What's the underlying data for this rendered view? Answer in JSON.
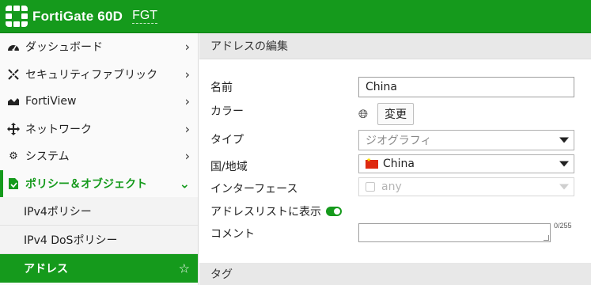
{
  "header": {
    "brand": "FortiGate 60D",
    "hostname": "FGT",
    "brand_color": "#159a1c"
  },
  "sidebar": {
    "items": [
      {
        "label": "ダッシュボード",
        "icon": "dashboard-icon"
      },
      {
        "label": "セキュリティファブリック",
        "icon": "security-fabric-icon"
      },
      {
        "label": "FortiView",
        "icon": "chart-icon"
      },
      {
        "label": "ネットワーク",
        "icon": "network-icon"
      },
      {
        "label": "システム",
        "icon": "gear-icon"
      },
      {
        "label": "ポリシー＆オブジェクト",
        "icon": "policy-icon",
        "expanded": true
      }
    ],
    "subitems": [
      {
        "label": "IPv4ポリシー"
      },
      {
        "label": "IPv4 DoSポリシー"
      },
      {
        "label": "アドレス",
        "selected": true
      }
    ]
  },
  "main": {
    "section_title": "アドレスの編集",
    "tag_section_title": "タグ",
    "form": {
      "name_label": "名前",
      "name_value": "China",
      "color_label": "カラー",
      "color_change_button": "変更",
      "type_label": "タイプ",
      "type_value": "ジオグラフィ",
      "country_label": "国/地域",
      "country_value": "China",
      "interface_label": "インターフェース",
      "interface_value": "any",
      "show_in_list_label": "アドレスリストに表示",
      "show_in_list_enabled": true,
      "comment_label": "コメント",
      "comment_value": "",
      "comment_counter": "0/255"
    }
  }
}
